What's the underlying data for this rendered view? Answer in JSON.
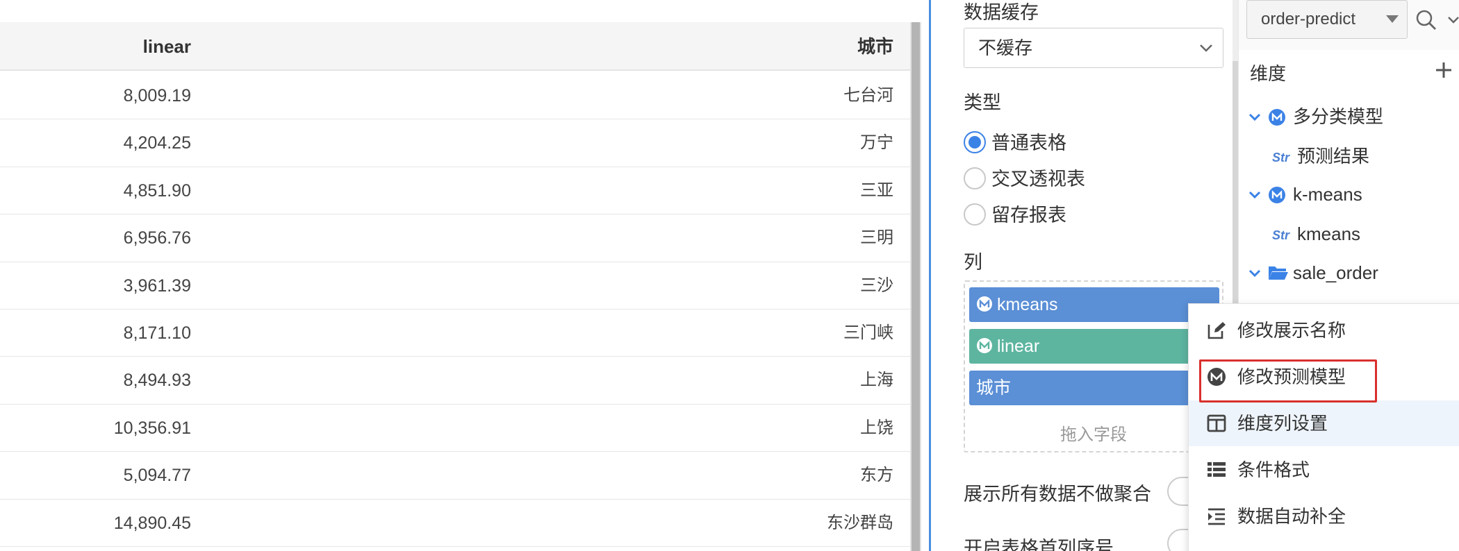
{
  "table": {
    "headers": {
      "linear": "linear",
      "city": "城市"
    },
    "rows": [
      {
        "linear": "8,009.19",
        "city": "七台河"
      },
      {
        "linear": "4,204.25",
        "city": "万宁"
      },
      {
        "linear": "4,851.90",
        "city": "三亚"
      },
      {
        "linear": "6,956.76",
        "city": "三明"
      },
      {
        "linear": "3,961.39",
        "city": "三沙"
      },
      {
        "linear": "8,171.10",
        "city": "三门峡"
      },
      {
        "linear": "8,494.93",
        "city": "上海"
      },
      {
        "linear": "10,356.91",
        "city": "上饶"
      },
      {
        "linear": "5,094.77",
        "city": "东方"
      },
      {
        "linear": "14,890.45",
        "city": "东沙群岛"
      }
    ]
  },
  "config": {
    "cache_label": "数据缓存",
    "cache_value": "不缓存",
    "type_label": "类型",
    "type_options": [
      "普通表格",
      "交叉透视表",
      "留存报表"
    ],
    "type_selected": "普通表格",
    "columns_label": "列",
    "columns": [
      {
        "label": "kmeans",
        "color": "#5b8fd6"
      },
      {
        "label": "linear",
        "color": "#5db5a0"
      },
      {
        "label": "城市",
        "color": "#5b8fd6"
      }
    ],
    "drag_hint": "拖入字段",
    "toggle_no_agg": "展示所有数据不做聚合",
    "toggle_row_index": "开启表格首列序号"
  },
  "fields": {
    "model_select": "order-predict",
    "dimension_label": "维度",
    "tree": {
      "node1": "多分类模型",
      "node1_child_tag": "Str",
      "node1_child": "预测结果",
      "node2": "k-means",
      "node2_child_tag": "Str",
      "node2_child": "kmeans",
      "node3": "sale_order"
    }
  },
  "context_menu": {
    "items": [
      {
        "label": "修改展示名称",
        "icon": "edit-icon"
      },
      {
        "label": "修改预测模型",
        "icon": "model-icon"
      },
      {
        "label": "维度列设置",
        "icon": "columns-icon"
      },
      {
        "label": "条件格式",
        "icon": "list-icon"
      },
      {
        "label": "数据自动补全",
        "icon": "indent-icon"
      }
    ]
  },
  "colors": {
    "accent": "#3b82e6",
    "highlight_border": "#d9302c",
    "chip_blue": "#5b8fd6",
    "chip_green": "#5db5a0"
  }
}
